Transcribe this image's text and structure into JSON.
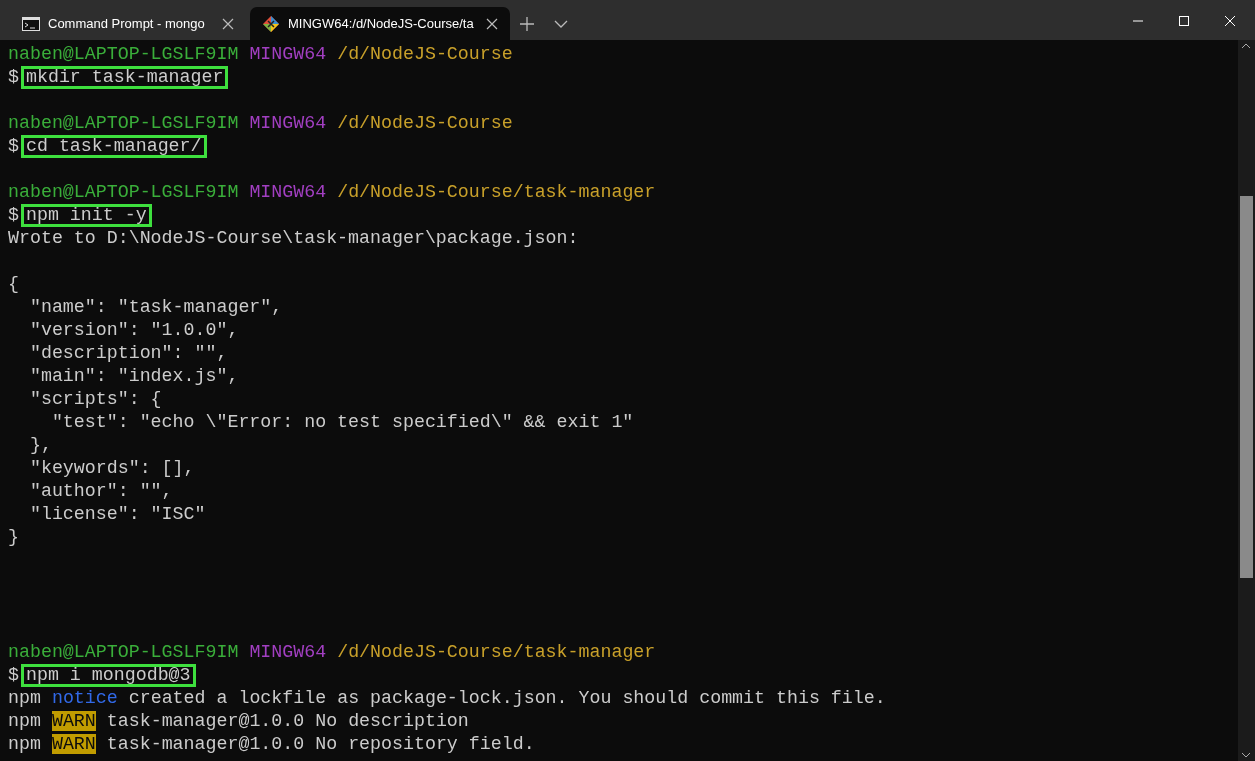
{
  "tabs": [
    {
      "title": "Command Prompt - mongo",
      "kind": "cmd",
      "selected": false
    },
    {
      "title": "MINGW64:/d/NodeJS-Course/ta",
      "kind": "bash",
      "selected": true
    }
  ],
  "terminal": {
    "lines": [
      {
        "kind": "prompt",
        "user": "naben@LAPTOP-LGSLF9IM",
        "system": "MINGW64",
        "path": "/d/NodeJS-Course"
      },
      {
        "kind": "command",
        "symbol": "$",
        "text": "mkdir task-manager",
        "highlighted": true
      },
      {
        "kind": "blank"
      },
      {
        "kind": "prompt",
        "user": "naben@LAPTOP-LGSLF9IM",
        "system": "MINGW64",
        "path": "/d/NodeJS-Course"
      },
      {
        "kind": "command",
        "symbol": "$",
        "text": "cd task-manager/",
        "highlighted": true
      },
      {
        "kind": "blank"
      },
      {
        "kind": "prompt",
        "user": "naben@LAPTOP-LGSLF9IM",
        "system": "MINGW64",
        "path": "/d/NodeJS-Course/task-manager"
      },
      {
        "kind": "command",
        "symbol": "$",
        "text": "npm init -y",
        "highlighted": true
      },
      {
        "kind": "output",
        "text": "Wrote to D:\\NodeJS-Course\\task-manager\\package.json:"
      },
      {
        "kind": "blank"
      },
      {
        "kind": "output",
        "text": "{"
      },
      {
        "kind": "output",
        "text": "  \"name\": \"task-manager\","
      },
      {
        "kind": "output",
        "text": "  \"version\": \"1.0.0\","
      },
      {
        "kind": "output",
        "text": "  \"description\": \"\","
      },
      {
        "kind": "output",
        "text": "  \"main\": \"index.js\","
      },
      {
        "kind": "output",
        "text": "  \"scripts\": {"
      },
      {
        "kind": "output",
        "text": "    \"test\": \"echo \\\"Error: no test specified\\\" && exit 1\""
      },
      {
        "kind": "output",
        "text": "  },"
      },
      {
        "kind": "output",
        "text": "  \"keywords\": [],"
      },
      {
        "kind": "output",
        "text": "  \"author\": \"\","
      },
      {
        "kind": "output",
        "text": "  \"license\": \"ISC\""
      },
      {
        "kind": "output",
        "text": "}"
      },
      {
        "kind": "blank"
      },
      {
        "kind": "blank"
      },
      {
        "kind": "blank"
      },
      {
        "kind": "blank"
      },
      {
        "kind": "prompt",
        "user": "naben@LAPTOP-LGSLF9IM",
        "system": "MINGW64",
        "path": "/d/NodeJS-Course/task-manager"
      },
      {
        "kind": "command",
        "symbol": "$",
        "text": "npm i mongodb@3",
        "highlighted": true
      },
      {
        "kind": "npm",
        "prefix": "npm",
        "level": "notice",
        "message": "created a lockfile as package-lock.json. You should commit this file."
      },
      {
        "kind": "npm",
        "prefix": "npm",
        "level": "WARN",
        "message": "task-manager@1.0.0 No description"
      },
      {
        "kind": "npm",
        "prefix": "npm",
        "level": "WARN",
        "message": "task-manager@1.0.0 No repository field."
      }
    ]
  }
}
